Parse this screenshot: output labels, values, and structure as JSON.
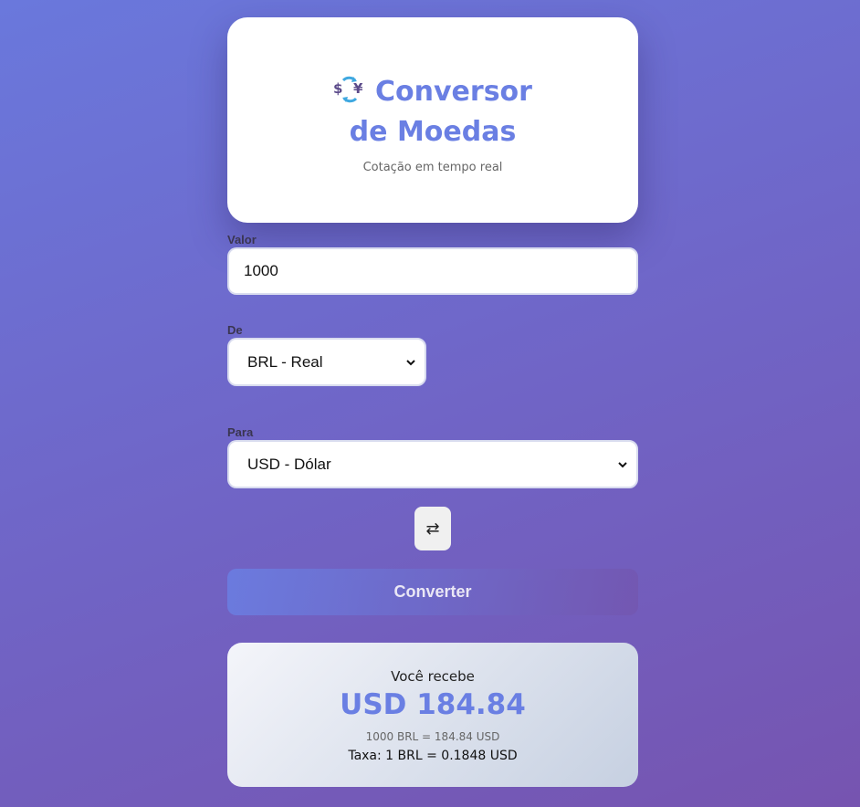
{
  "header": {
    "icon": "currency-exchange-icon",
    "title": "Conversor de Moedas",
    "subtitle": "Cotação em tempo real"
  },
  "form": {
    "amount": {
      "label": "Valor",
      "value": "1000"
    },
    "from": {
      "label": "De",
      "selected": "BRL - Real"
    },
    "to": {
      "label": "Para",
      "selected": "USD - Dólar"
    },
    "swap_icon": "⇄",
    "convert_label": "Converter"
  },
  "result": {
    "label": "Você recebe",
    "amount": "USD 184.84",
    "detail": "1000 BRL = 184.84 USD",
    "rate": "Taxa: 1 BRL = 0.1848 USD"
  },
  "colors": {
    "accent": "#6a7fe3",
    "gradient_end": "#7654b0"
  }
}
